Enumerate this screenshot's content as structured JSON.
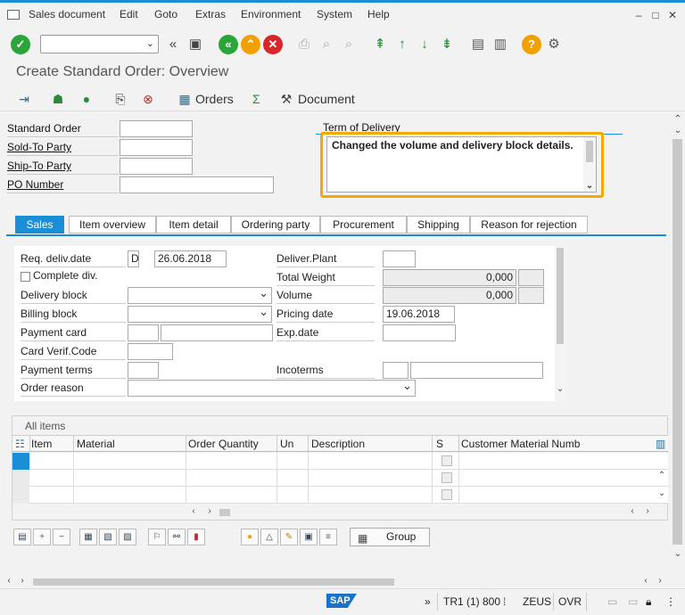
{
  "menubar": {
    "items": [
      "Sales document",
      "Edit",
      "Goto",
      "Extras",
      "Environment",
      "System",
      "Help"
    ]
  },
  "toolbar": {
    "command_value": "",
    "icons": [
      "enter-icon",
      "back-icon",
      "save-icon",
      "back-nav-icon",
      "exit-icon",
      "cancel-icon",
      "print-icon",
      "find-icon",
      "find-next-icon",
      "first-page-icon",
      "previous-page-icon",
      "next-page-icon",
      "last-page-icon",
      "create-session-icon",
      "shortcut-icon",
      "help-icon",
      "customize-icon"
    ]
  },
  "page": {
    "title": "Create Standard Order: Overview"
  },
  "appbar": {
    "orders_label": "Orders",
    "sum_label": "Σ",
    "document_label": "Document"
  },
  "header_fields": {
    "standard_order": {
      "label": "Standard Order",
      "value": ""
    },
    "sold_to_party": {
      "label": "Sold-To Party",
      "value": ""
    },
    "ship_to_party": {
      "label": "Ship-To Party",
      "value": ""
    },
    "po_number": {
      "label": "PO Number",
      "value": ""
    }
  },
  "term_of_delivery": {
    "title": "Term of Delivery",
    "text": "Changed the volume and delivery block details."
  },
  "tabs": [
    "Sales",
    "Item overview",
    "Item detail",
    "Ordering party",
    "Procurement",
    "Shipping",
    "Reason for rejection"
  ],
  "active_tab": "Sales",
  "sales_tab": {
    "req_deliv_date_label": "Req. deliv.date",
    "req_deliv_date_type": "D",
    "req_deliv_date": "26.06.2018",
    "complete_div_label": "Complete div.",
    "delivery_block_label": "Delivery block",
    "delivery_block_value": "",
    "billing_block_label": "Billing block",
    "billing_block_value": "",
    "payment_card_label": "Payment card",
    "card_verif_label": "Card Verif.Code",
    "payment_terms_label": "Payment terms",
    "order_reason_label": "Order reason",
    "order_reason_value": "",
    "deliver_plant_label": "Deliver.Plant",
    "total_weight_label": "Total Weight",
    "total_weight_value": "0,000",
    "volume_label": "Volume",
    "volume_value": "0,000",
    "pricing_date_label": "Pricing date",
    "pricing_date_value": "19.06.2018",
    "exp_date_label": "Exp.date",
    "incoterms_label": "Incoterms"
  },
  "items": {
    "title": "All items",
    "columns": [
      "Item",
      "Material",
      "Order Quantity",
      "Un",
      "Description",
      "S",
      "Customer Material Numb"
    ],
    "rows": [
      {
        "item": "",
        "material": "",
        "qty": "",
        "un": "",
        "desc": "",
        "cmn": ""
      },
      {
        "item": "",
        "material": "",
        "qty": "",
        "un": "",
        "desc": "",
        "cmn": ""
      },
      {
        "item": "",
        "material": "",
        "qty": "",
        "un": "",
        "desc": "",
        "cmn": ""
      }
    ],
    "group_button": "Group"
  },
  "statusbar": {
    "logo": "SAP",
    "session": "TR1 (1) 800",
    "server": "ZEUS",
    "mode": "OVR"
  }
}
